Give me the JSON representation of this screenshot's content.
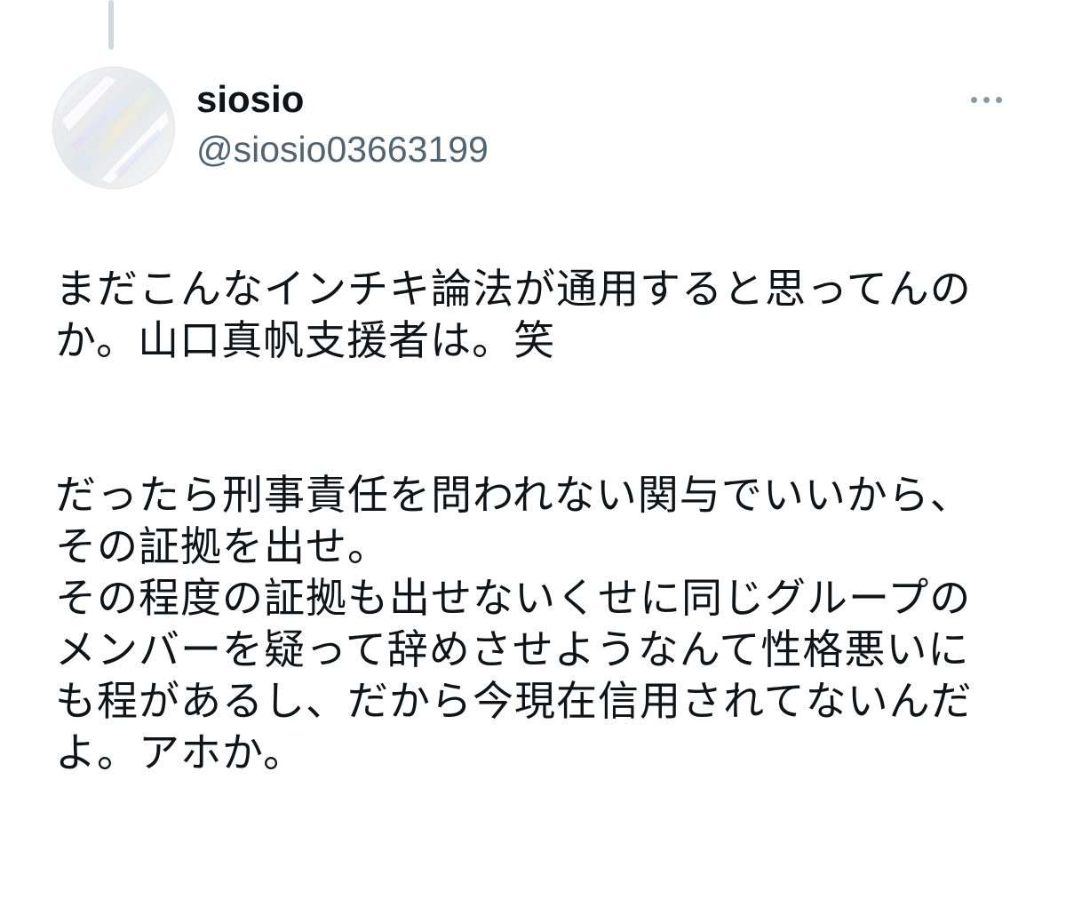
{
  "thread": {
    "connector": "thread-connector-line"
  },
  "author": {
    "display_name": "siosio",
    "handle": "@siosio03663199",
    "avatar_icon": "iridescent-avatar-image"
  },
  "actions": {
    "more_icon": "more-dots-icon"
  },
  "tweet": {
    "paragraph_1": [
      "まだこんなインチキ論法が通用すると思ってんの",
      "か。山口真帆支援者は。笑"
    ],
    "paragraph_2": [
      "だったら刑事責任を問われない関与でいいから、",
      "その証拠を出せ。",
      "その程度の証拠も出せないくせに同じグループの",
      "メンバーを疑って辞めさせようなんて性格悪いに",
      "も程があるし、だから今現在信用されてないんだ",
      "よ。アホか。"
    ]
  },
  "colors": {
    "text_primary": "#0f1419",
    "text_secondary": "#536471",
    "thread_line": "#cfd9de",
    "more_dots": "#8b98a5",
    "background": "#ffffff"
  }
}
